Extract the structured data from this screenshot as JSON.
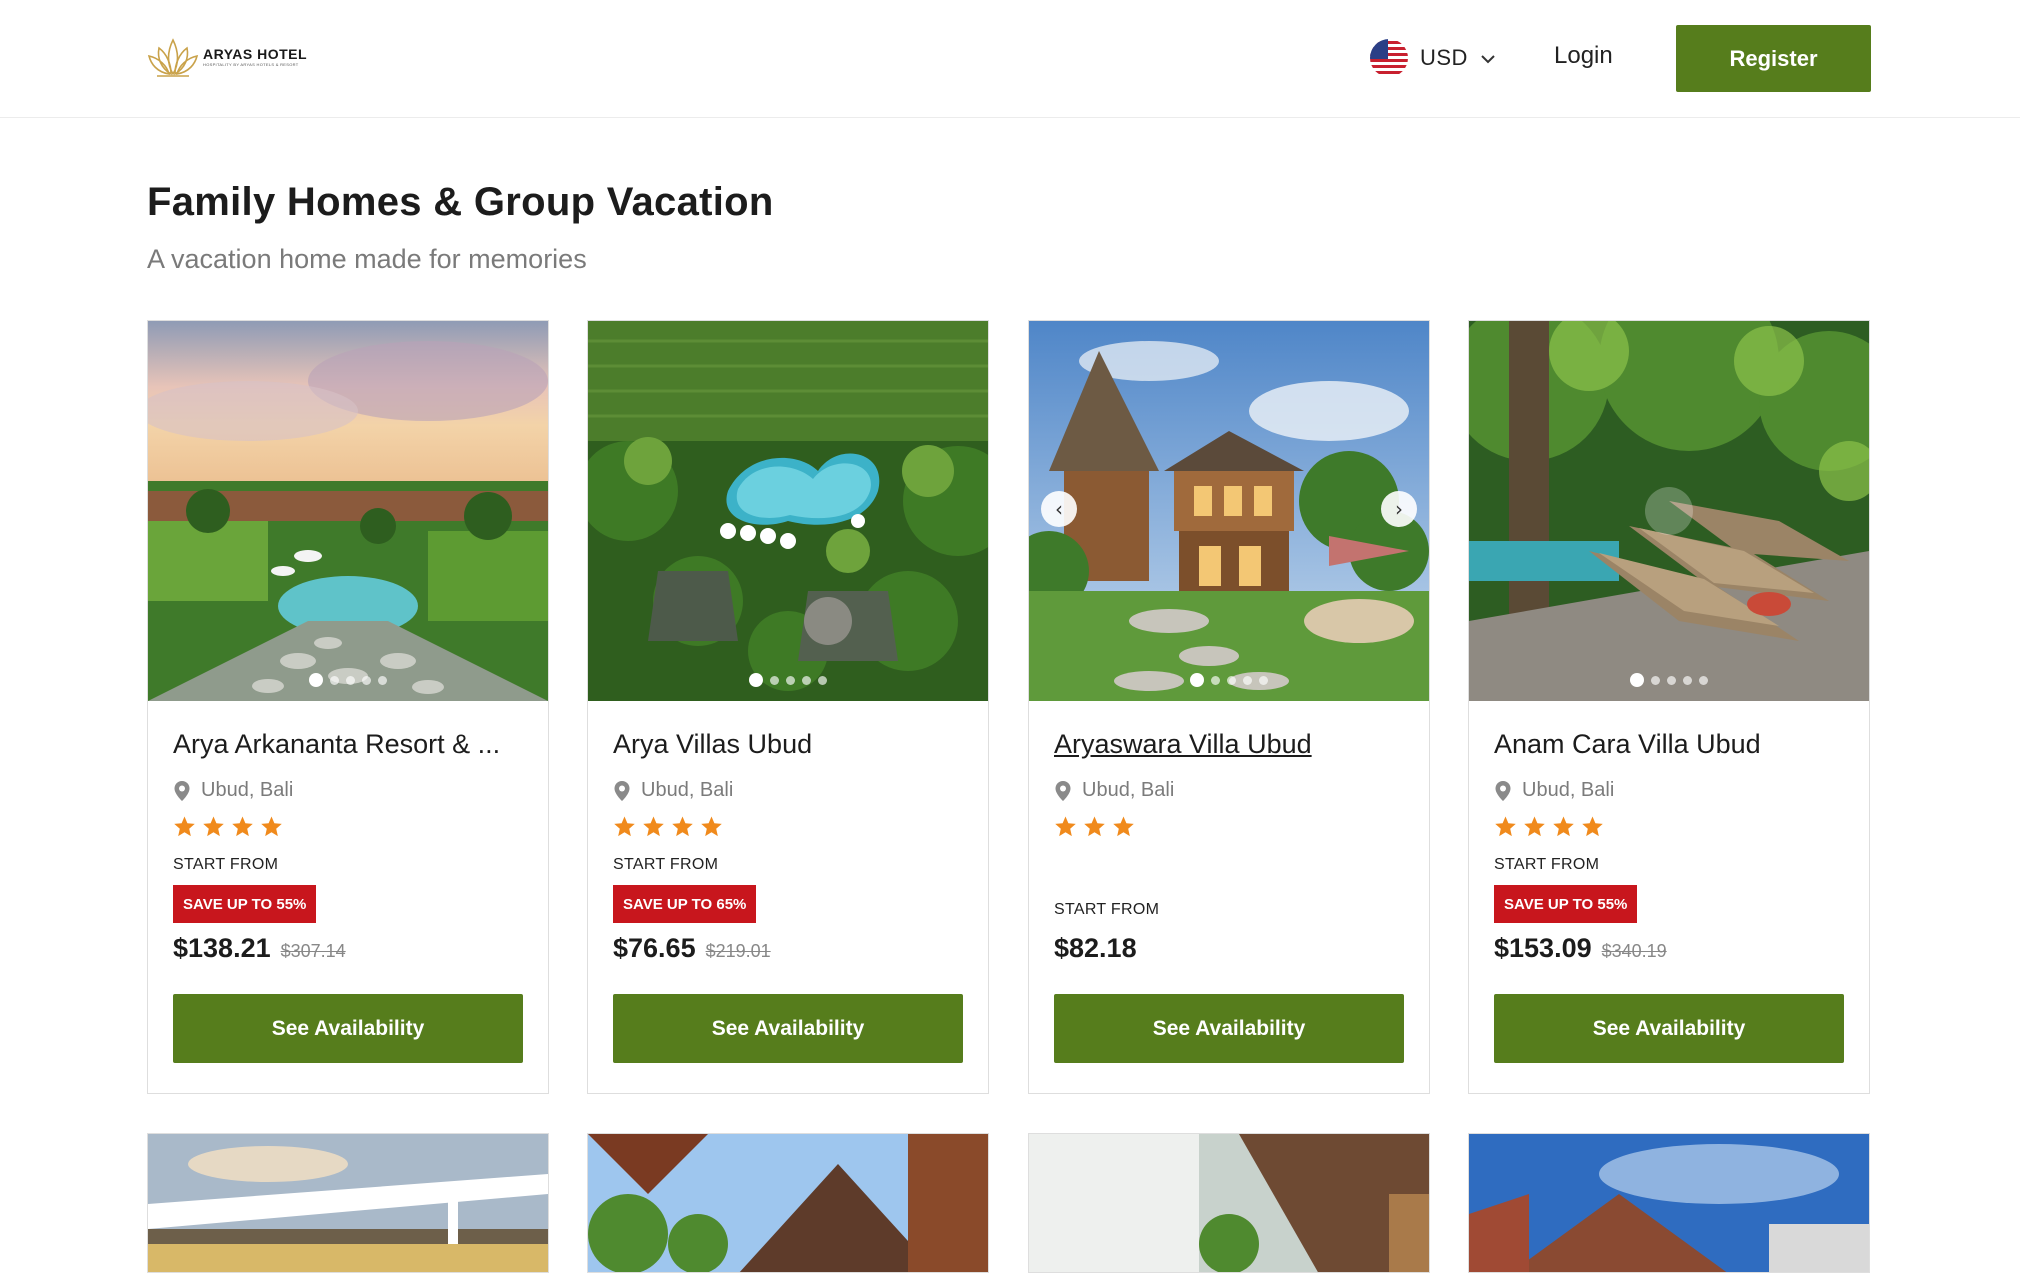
{
  "header": {
    "brand_name": "ARYAS HOTEL",
    "brand_tagline": "HOSPITALITY BY ARYAS HOTELS & RESORT",
    "currency": "USD",
    "login_label": "Login",
    "register_label": "Register"
  },
  "section": {
    "title": "Family Homes & Group Vacation",
    "subtitle": "A vacation home made for memories"
  },
  "cards": [
    {
      "name": "Arya Arkananta Resort & ...",
      "location": "Ubud, Bali",
      "stars": 4,
      "start_label": "START FROM",
      "badge": "SAVE UP TO 55%",
      "price": "$138.21",
      "old_price": "$307.14",
      "button": "See Availability",
      "slides": 5,
      "active_slide": 1
    },
    {
      "name": "Arya Villas Ubud",
      "location": "Ubud, Bali",
      "stars": 4,
      "start_label": "START FROM",
      "badge": "SAVE UP TO 65%",
      "price": "$76.65",
      "old_price": "$219.01",
      "button": "See Availability",
      "slides": 5,
      "active_slide": 1
    },
    {
      "name": "Aryaswara Villa Ubud",
      "location": "Ubud, Bali",
      "stars": 3,
      "start_label": "START FROM",
      "badge": "",
      "price": "$82.18",
      "old_price": "",
      "button": "See Availability",
      "slides": 5,
      "active_slide": 1
    },
    {
      "name": "Anam Cara Villa Ubud",
      "location": "Ubud, Bali",
      "stars": 4,
      "start_label": "START FROM",
      "badge": "SAVE UP TO 55%",
      "price": "$153.09",
      "old_price": "$340.19",
      "button": "See Availability",
      "slides": 5,
      "active_slide": 1
    }
  ],
  "icons": {
    "location": "map-pin-icon",
    "star": "star-icon",
    "chevron": "chevron-down-icon",
    "prev": "chevron-left-icon",
    "next": "chevron-right-icon"
  },
  "colors": {
    "accent_green": "#567d1c",
    "badge_red": "#c8161d",
    "star_orange": "#f08a1c",
    "muted_text": "#7a7a7a"
  }
}
